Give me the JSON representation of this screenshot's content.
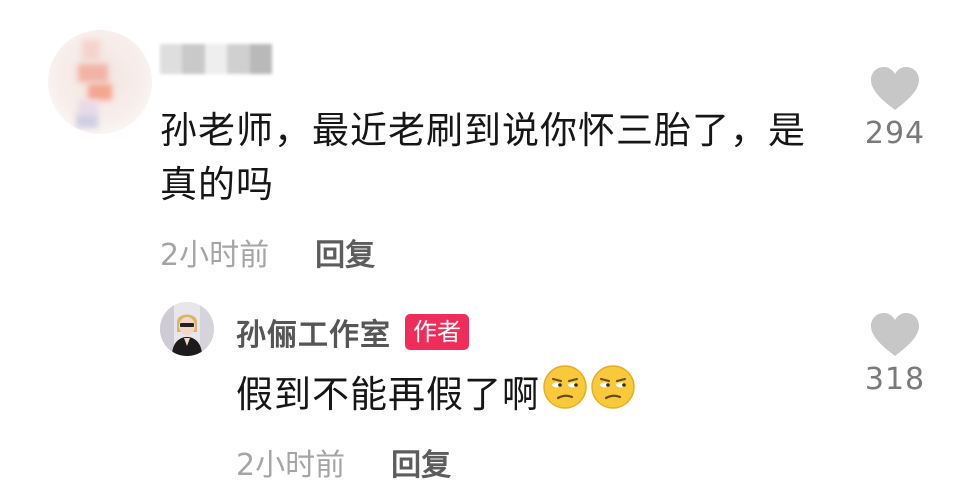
{
  "comment": {
    "text": "孙老师，最近老刷到说你怀三胎了，是真的吗",
    "time": "2小时前",
    "reply_label": "回复",
    "like_count": "294"
  },
  "reply": {
    "author_name": "孙俪工作室",
    "author_badge": "作者",
    "text": "假到不能再假了啊",
    "emoji_names": [
      "unamused-face-emoji",
      "unamused-face-emoji"
    ],
    "time": "2小时前",
    "reply_label": "回复",
    "like_count": "318"
  },
  "colors": {
    "badge": "#f02d5a",
    "heart": "#c7c7c7",
    "muted_text": "#a5a5a5"
  }
}
